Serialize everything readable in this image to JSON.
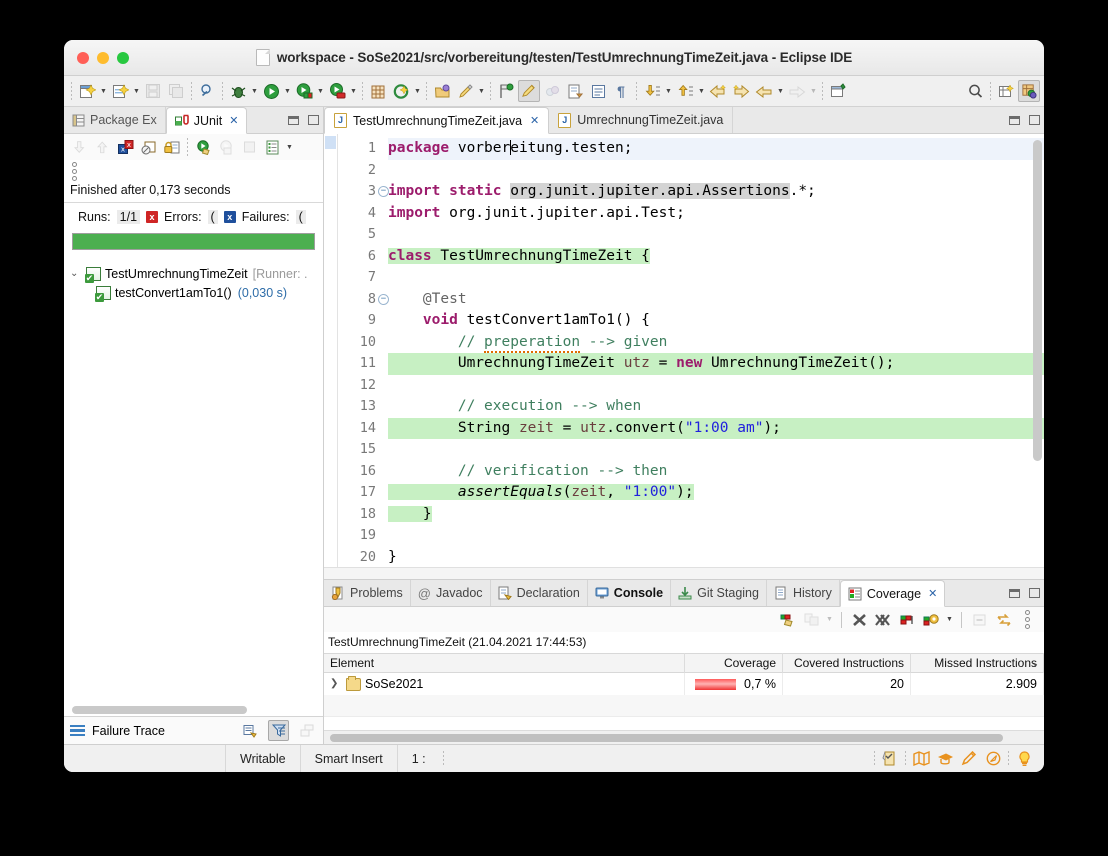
{
  "window": {
    "title": "workspace - SoSe2021/src/vorbereitung/testen/TestUmrechnungTimeZeit.java - Eclipse IDE",
    "traffic": {
      "close": "close-window",
      "minimize": "minimize-window",
      "zoom": "zoom-window"
    }
  },
  "toolbar": {
    "items": [
      {
        "name": "new-wizard",
        "glyph": "🗎",
        "dropdown": true,
        "enabled": true
      },
      {
        "name": "new-java-class",
        "glyph": "🗒",
        "dropdown": true,
        "enabled": true
      },
      {
        "name": "save",
        "glyph": "💾",
        "dropdown": false,
        "enabled": false
      },
      {
        "name": "save-all",
        "glyph": "🗂",
        "dropdown": false,
        "enabled": false
      },
      {
        "name": "search",
        "glyph": "🔍",
        "dropdown": false,
        "enabled": true
      },
      {
        "name": "debug",
        "glyph": "🐞",
        "dropdown": true,
        "enabled": true
      },
      {
        "name": "run",
        "glyph": "▶",
        "dropdown": true,
        "enabled": true
      },
      {
        "name": "coverage",
        "glyph": "▶",
        "dropdown": true,
        "enabled": true
      },
      {
        "name": "run-external-tools",
        "glyph": "▶",
        "dropdown": true,
        "enabled": true
      },
      {
        "name": "new-java-project",
        "glyph": "⊞",
        "dropdown": false,
        "enabled": true
      },
      {
        "name": "open-type",
        "glyph": "Ⓖ",
        "dropdown": true,
        "enabled": true
      },
      {
        "name": "open-resource",
        "glyph": "📂",
        "dropdown": false,
        "enabled": true
      },
      {
        "name": "mark-occurrences",
        "glyph": "✎",
        "dropdown": true,
        "enabled": true
      },
      {
        "name": "skip-breakpoints",
        "glyph": "⚑",
        "dropdown": false,
        "enabled": true
      },
      {
        "name": "toggle-highlight",
        "glyph": "✏",
        "dropdown": false,
        "enabled": true,
        "pressed": true
      },
      {
        "name": "toggle-marks",
        "glyph": "◌",
        "dropdown": false,
        "enabled": false
      },
      {
        "name": "next-annotation-settings",
        "glyph": "🗐",
        "dropdown": false,
        "enabled": true
      },
      {
        "name": "show-whitespace",
        "glyph": "▤",
        "dropdown": false,
        "enabled": true
      },
      {
        "name": "pilcrow",
        "glyph": "¶",
        "dropdown": false,
        "enabled": true
      },
      {
        "name": "next-annotation",
        "glyph": "↓",
        "dropdown": true,
        "enabled": true
      },
      {
        "name": "previous-annotation",
        "glyph": "↑",
        "dropdown": true,
        "enabled": true
      },
      {
        "name": "back-to-last-edit",
        "glyph": "⇦",
        "dropdown": false,
        "enabled": true
      },
      {
        "name": "forward-edit",
        "glyph": "⇨",
        "dropdown": false,
        "enabled": true
      },
      {
        "name": "navigate-back",
        "glyph": "⇦",
        "dropdown": true,
        "enabled": true
      },
      {
        "name": "navigate-forward",
        "glyph": "⇨",
        "dropdown": true,
        "enabled": false
      },
      {
        "name": "new-window",
        "glyph": "🗔",
        "dropdown": false,
        "enabled": true
      }
    ],
    "right": [
      {
        "name": "quick-access-search-icon",
        "glyph": "🔍"
      },
      {
        "name": "open-perspective-icon",
        "glyph": "⊞"
      },
      {
        "name": "java-perspective-icon",
        "glyph": "Ⓙ",
        "pressed": true
      }
    ]
  },
  "left_panel": {
    "tabs": [
      {
        "label": "Package Ex",
        "name": "tab-package-explorer",
        "active": false,
        "icon": "package-explorer-icon",
        "closeable": false
      },
      {
        "label": "JUnit",
        "name": "tab-junit",
        "active": true,
        "icon": "junit-icon",
        "closeable": true
      }
    ],
    "view_buttons": [
      {
        "name": "minimize-view-button",
        "glyph": "—"
      },
      {
        "name": "maximize-view-button",
        "glyph": "□"
      }
    ],
    "junit_toolbar": [
      {
        "name": "next-failure-icon",
        "glyph": "↓",
        "enabled": false
      },
      {
        "name": "previous-failure-icon",
        "glyph": "↑",
        "enabled": false
      },
      {
        "name": "show-failures-only-icon",
        "glyph": "☒",
        "enabled": true
      },
      {
        "name": "show-ignored-only-icon",
        "glyph": "⊘",
        "enabled": true
      },
      {
        "name": "scroll-lock-icon",
        "glyph": "🔒",
        "enabled": true
      },
      {
        "name": "rerun-test-icon",
        "glyph": "▶",
        "enabled": true
      },
      {
        "name": "rerun-failed-first-icon",
        "glyph": "▶",
        "enabled": false
      },
      {
        "name": "stop-test-icon",
        "glyph": "■",
        "enabled": false
      },
      {
        "name": "test-run-history-icon",
        "glyph": "☰",
        "enabled": true,
        "dropdown": true
      }
    ],
    "status": "Finished after 0,173 seconds",
    "counters": {
      "runs_label": "Runs:",
      "runs_value": "1/1",
      "errors_label": "Errors:",
      "errors_value": "(",
      "failures_label": "Failures:",
      "failures_value": "("
    },
    "progress": {
      "percent": 100,
      "color": "#4caf50"
    },
    "tree": [
      {
        "name": "junit-tree-class",
        "label": "TestUmrechnungTimeZeit",
        "suffix": "[Runner: .",
        "expanded": true,
        "level": 1,
        "duration": ""
      },
      {
        "name": "junit-tree-method",
        "label": "testConvert1amTo1()",
        "suffix": "",
        "expanded": false,
        "level": 2,
        "duration": "(0,030 s)"
      }
    ],
    "failure_trace": {
      "label": "Failure Trace",
      "buttons": [
        {
          "name": "compare-result-icon",
          "glyph": "❐",
          "enabled": true
        },
        {
          "name": "filter-stack-trace-icon",
          "glyph": "∇",
          "enabled": true,
          "pressed": true
        },
        {
          "name": "maximize-trace-icon",
          "glyph": "⧉",
          "enabled": false
        }
      ]
    }
  },
  "editor": {
    "tabs": [
      {
        "label": "TestUmrechnungTimeZeit.java",
        "name": "editor-tab-test",
        "active": true,
        "closeable": true
      },
      {
        "label": "UmrechnungTimeZeit.java",
        "name": "editor-tab-main",
        "active": false,
        "closeable": false
      }
    ],
    "view_buttons": [
      {
        "name": "minimize-editor-button",
        "glyph": "—"
      },
      {
        "name": "maximize-editor-button",
        "glyph": "□"
      }
    ],
    "line_numbers": [
      "1",
      "2",
      "3",
      "4",
      "5",
      "6",
      "7",
      "8",
      "9",
      "10",
      "11",
      "12",
      "13",
      "14",
      "15",
      "16",
      "17",
      "18",
      "19",
      "20"
    ],
    "folds": {
      "3": true,
      "8": true
    },
    "lines": [
      {
        "n": 1,
        "highlight": "cursor",
        "text": "package vorbereitung.testen;"
      },
      {
        "n": 2,
        "highlight": "none",
        "text": ""
      },
      {
        "n": 3,
        "highlight": "none",
        "text": "import static org.junit.jupiter.api.Assertions.*;"
      },
      {
        "n": 4,
        "highlight": "none",
        "text": "import org.junit.jupiter.api.Test;"
      },
      {
        "n": 5,
        "highlight": "none",
        "text": ""
      },
      {
        "n": 6,
        "highlight": "covered",
        "text": "class TestUmrechnungTimeZeit {"
      },
      {
        "n": 7,
        "highlight": "none",
        "text": ""
      },
      {
        "n": 8,
        "highlight": "none",
        "text": "    @Test"
      },
      {
        "n": 9,
        "highlight": "none",
        "text": "    void testConvert1amTo1() {"
      },
      {
        "n": 10,
        "highlight": "none",
        "text": "        // preperation --> given"
      },
      {
        "n": 11,
        "highlight": "covered",
        "text": "        UmrechnungTimeZeit utz = new UmrechnungTimeZeit();"
      },
      {
        "n": 12,
        "highlight": "none",
        "text": ""
      },
      {
        "n": 13,
        "highlight": "none",
        "text": "        // execution --> when"
      },
      {
        "n": 14,
        "highlight": "covered",
        "text": "        String zeit = utz.convert(\"1:00 am\");"
      },
      {
        "n": 15,
        "highlight": "none",
        "text": ""
      },
      {
        "n": 16,
        "highlight": "none",
        "text": "        // verification --> then"
      },
      {
        "n": 17,
        "highlight": "covered",
        "text": "        assertEquals(zeit, \"1:00\");"
      },
      {
        "n": 18,
        "highlight": "covered",
        "text": "    }"
      },
      {
        "n": 19,
        "highlight": "none",
        "text": ""
      },
      {
        "n": 20,
        "highlight": "none",
        "text": "}"
      }
    ]
  },
  "bottom_panel": {
    "tabs": [
      {
        "label": "Problems",
        "name": "tab-problems",
        "active": false,
        "bold": false,
        "icon": "problems-icon"
      },
      {
        "label": "Javadoc",
        "name": "tab-javadoc",
        "active": false,
        "bold": false,
        "icon": "javadoc-icon"
      },
      {
        "label": "Declaration",
        "name": "tab-declaration",
        "active": false,
        "bold": false,
        "icon": "declaration-icon"
      },
      {
        "label": "Console",
        "name": "tab-console",
        "active": false,
        "bold": true,
        "icon": "console-icon"
      },
      {
        "label": "Git Staging",
        "name": "tab-git-staging",
        "active": false,
        "bold": false,
        "icon": "git-staging-icon"
      },
      {
        "label": "History",
        "name": "tab-history",
        "active": false,
        "bold": false,
        "icon": "history-icon"
      },
      {
        "label": "Coverage",
        "name": "tab-coverage",
        "active": true,
        "bold": false,
        "icon": "coverage-icon",
        "closeable": true
      }
    ],
    "view_buttons": [
      {
        "name": "minimize-bottom-button",
        "glyph": "—"
      },
      {
        "name": "maximize-bottom-button",
        "glyph": "□"
      }
    ],
    "coverage_toolbar": [
      {
        "name": "relaunch-coverage-session-icon",
        "glyph": "▰",
        "enabled": true
      },
      {
        "name": "merge-sessions-icon",
        "glyph": "⧉",
        "enabled": false,
        "dropdown": true
      },
      {
        "name": "remove-session-icon",
        "glyph": "✕",
        "enabled": true
      },
      {
        "name": "remove-all-sessions-icon",
        "glyph": "✖",
        "enabled": true
      },
      {
        "name": "import-session-icon",
        "glyph": "■",
        "enabled": true
      },
      {
        "name": "select-session-icon",
        "glyph": "⚙",
        "enabled": true,
        "dropdown": true
      },
      {
        "name": "collapse-all-icon",
        "glyph": "⊟",
        "enabled": false
      },
      {
        "name": "link-with-selection-icon",
        "glyph": "⇄",
        "enabled": true
      },
      {
        "name": "view-menu-icon",
        "glyph": "⋮",
        "enabled": true
      }
    ],
    "session": "TestUmrechnungTimeZeit (21.04.2021 17:44:53)",
    "columns": [
      "Element",
      "Coverage",
      "Covered Instructions",
      "Missed Instructions"
    ],
    "rows": [
      {
        "name": "coverage-row-sose2021",
        "element": "SoSe2021",
        "coverage": "0,7 %",
        "covered_instructions": "20",
        "missed_instructions": "2.909",
        "expanded": false,
        "bar_color": "#f03434"
      }
    ]
  },
  "statusbar": {
    "writable": "Writable",
    "insert_mode": "Smart Insert",
    "position": "1 :",
    "icons": [
      {
        "name": "editor-status-icon",
        "glyph": "🗋"
      },
      {
        "name": "map-icon",
        "glyph": "📖"
      },
      {
        "name": "graduation-cap-icon",
        "glyph": "🎓"
      },
      {
        "name": "pen-icon",
        "glyph": "✒"
      },
      {
        "name": "compass-icon",
        "glyph": "◎"
      },
      {
        "name": "tip-of-the-day-icon",
        "glyph": "💡"
      }
    ]
  }
}
